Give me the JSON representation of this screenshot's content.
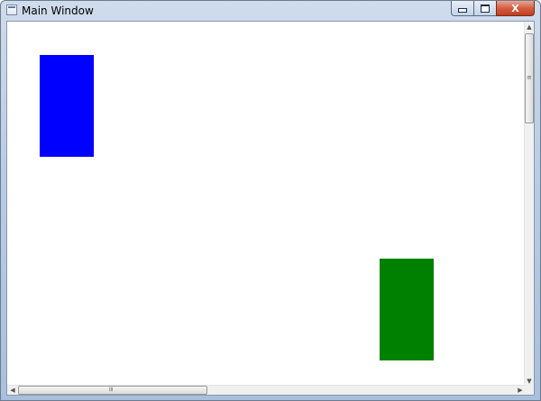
{
  "window": {
    "title": "Main Window"
  },
  "caption": {
    "close_label": "X"
  },
  "scrollbars": {
    "grip_glyph": "≡",
    "arrow_up": "▲",
    "arrow_down": "▼",
    "arrow_left": "◀",
    "arrow_right": "▶"
  },
  "shapes": [
    {
      "name": "blue-rectangle",
      "color": "#0000ff"
    },
    {
      "name": "green-rectangle",
      "color": "#008000"
    }
  ]
}
